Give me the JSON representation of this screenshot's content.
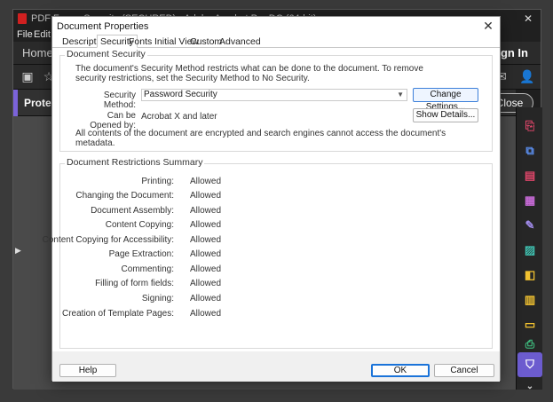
{
  "background_app": {
    "title": "PDF Forms Security (SECURED) - Adobe Acrobat Pro DC (64-bit)",
    "menu": [
      "File",
      "Edit"
    ],
    "home_tab": "Home",
    "sign_in": "Sign In",
    "protect_label": "Protect",
    "close_label": "Close"
  },
  "dialog": {
    "title": "Document Properties",
    "tabs": [
      "Description",
      "Security",
      "Fonts",
      "Initial View",
      "Custom",
      "Advanced"
    ],
    "active_tab": "Security",
    "security": {
      "legend": "Document Security",
      "intro_line1": "The document's Security Method restricts what can be done to the document. To remove",
      "intro_line2": "security restrictions, set the Security Method to No Security.",
      "method_label": "Security Method:",
      "method_value": "Password Security",
      "change_settings": "Change Settings...",
      "opened_by_label": "Can be Opened by:",
      "opened_by_value": "Acrobat X and later",
      "show_details": "Show Details...",
      "encrypted_line1": "All contents of the document are encrypted and search engines cannot access the document's",
      "encrypted_line2": "metadata."
    },
    "restrictions": {
      "legend": "Document Restrictions Summary",
      "rows": [
        {
          "label": "Printing:",
          "value": "Allowed"
        },
        {
          "label": "Changing the Document:",
          "value": "Allowed"
        },
        {
          "label": "Document Assembly:",
          "value": "Allowed"
        },
        {
          "label": "Content Copying:",
          "value": "Allowed"
        },
        {
          "label": "Content Copying for Accessibility:",
          "value": "Allowed"
        },
        {
          "label": "Page Extraction:",
          "value": "Allowed"
        },
        {
          "label": "Commenting:",
          "value": "Allowed"
        },
        {
          "label": "Filling of form fields:",
          "value": "Allowed"
        },
        {
          "label": "Signing:",
          "value": "Allowed"
        },
        {
          "label": "Creation of Template Pages:",
          "value": "Allowed"
        }
      ]
    },
    "footer": {
      "help": "Help",
      "ok": "OK",
      "cancel": "Cancel"
    }
  },
  "colors": {
    "accent_purple": "#6c5ccf",
    "focus_blue": "#1a73d9"
  },
  "rail_icons": [
    "pdf-export-icon",
    "combine-icon",
    "organize-icon",
    "edit-icon",
    "sign-icon",
    "fill-icon",
    "compare-icon",
    "protect-doc-icon",
    "comment-icon",
    "print-icon",
    "protect-shield-icon",
    "chevron-down-icon"
  ]
}
